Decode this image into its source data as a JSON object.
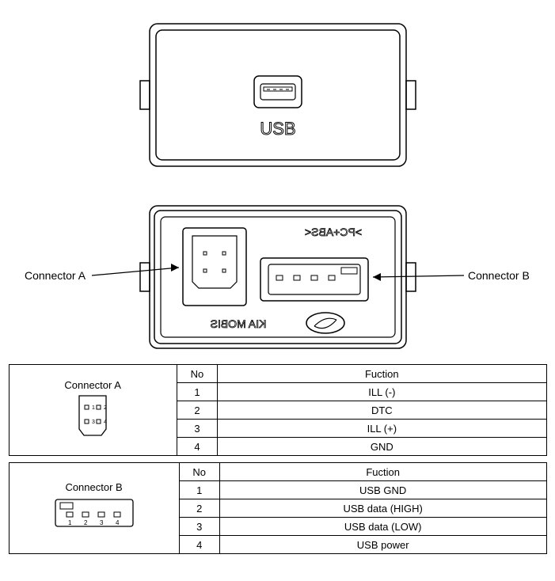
{
  "front_label": "USB",
  "back_text": ">PC+ABS<",
  "back_brand_1": "KIA MOBIS",
  "label_connA": "Connector A",
  "label_connB": "Connector B",
  "tableA": {
    "header_conn": "Connector A",
    "header_no": "No",
    "header_func": "Fuction",
    "rows": [
      {
        "no": "1",
        "func": "ILL (-)"
      },
      {
        "no": "2",
        "func": "DTC"
      },
      {
        "no": "3",
        "func": "ILL (+)"
      },
      {
        "no": "4",
        "func": "GND"
      }
    ],
    "pins": [
      "1",
      "2",
      "3",
      "4"
    ]
  },
  "tableB": {
    "header_conn": "Connector B",
    "header_no": "No",
    "header_func": "Fuction",
    "rows": [
      {
        "no": "1",
        "func": "USB GND"
      },
      {
        "no": "2",
        "func": "USB data (HIGH)"
      },
      {
        "no": "3",
        "func": "USB data (LOW)"
      },
      {
        "no": "4",
        "func": "USB power"
      }
    ],
    "pins": [
      "1",
      "2",
      "3",
      "4"
    ]
  }
}
